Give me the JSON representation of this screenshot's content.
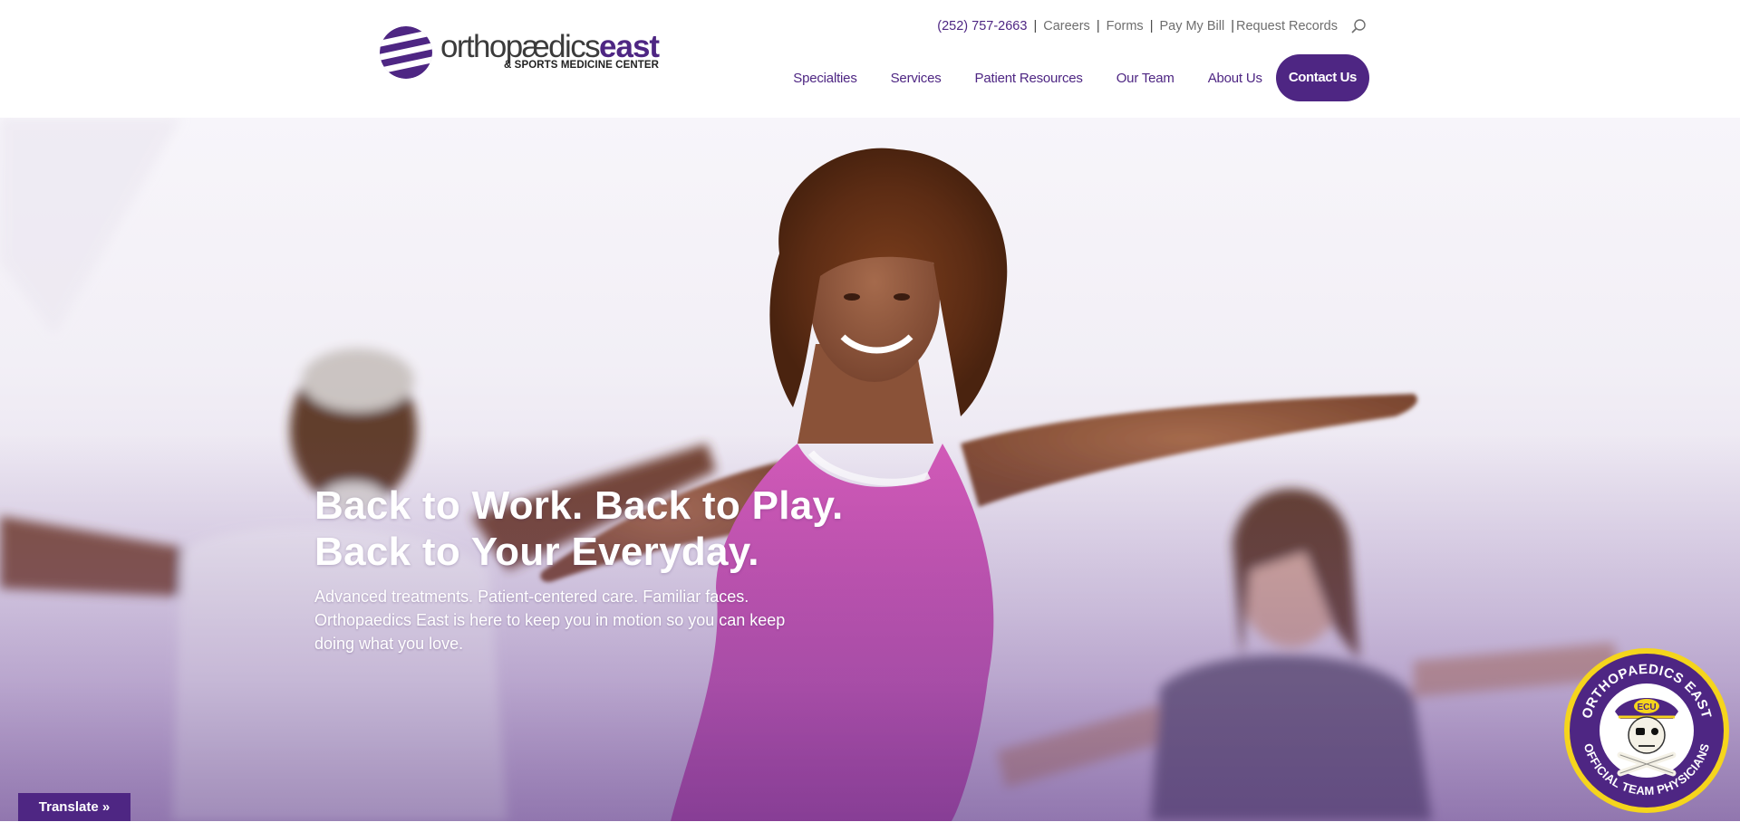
{
  "logo": {
    "name_light": "orthopædics",
    "name_bold": "east",
    "tagline": "& SPORTS MEDICINE CENTER"
  },
  "utility": {
    "phone": "(252) 757-2663",
    "links": [
      "Careers",
      "Forms",
      "Pay My Bill",
      "Request Records"
    ],
    "search_icon": "search-icon"
  },
  "nav": {
    "items": [
      "Specialties",
      "Services",
      "Patient Resources",
      "Our Team",
      "About Us"
    ],
    "cta": "Contact Us"
  },
  "hero": {
    "title_line1": "Back to Work. Back to Play.",
    "title_line2": "Back to Your Everyday.",
    "text_line1": "Advanced treatments. Patient-centered care. Familiar faces.",
    "text_line2": "Orthopaedics East is here to keep you in motion so you can keep",
    "text_line3": "doing what you love."
  },
  "translate": {
    "label": "Translate »"
  },
  "badge": {
    "top_text": "ORTHOPAEDICS EAST",
    "bottom_text": "OFFICIAL TEAM PHYSICIANS",
    "hat_text": "ECU"
  },
  "colors": {
    "brand_purple": "#4e2683",
    "gold": "#f5d51c",
    "text_gray": "#6e6e6e"
  }
}
